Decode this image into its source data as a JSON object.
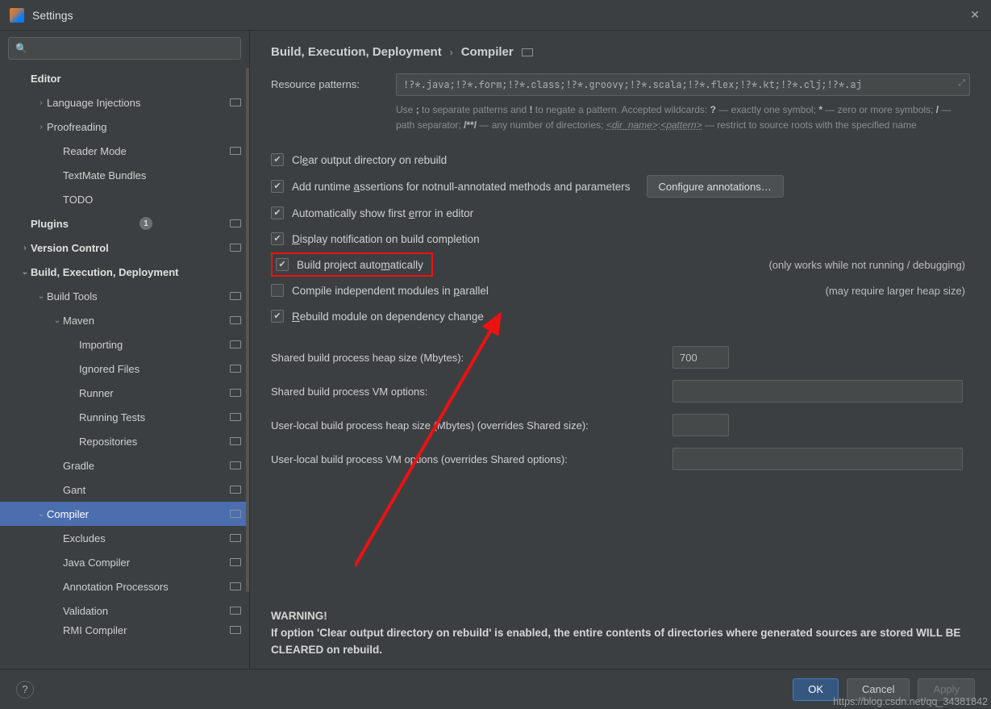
{
  "window": {
    "title": "Settings"
  },
  "sidebar": {
    "search_placeholder": "",
    "items": [
      {
        "label": "Editor",
        "depth": 0,
        "header": true,
        "arrow": "",
        "badge": false
      },
      {
        "label": "Language Injections",
        "depth": 1,
        "arrow": "›",
        "badge": true
      },
      {
        "label": "Proofreading",
        "depth": 1,
        "arrow": "›",
        "badge": false
      },
      {
        "label": "Reader Mode",
        "depth": 2,
        "arrow": "",
        "badge": true
      },
      {
        "label": "TextMate Bundles",
        "depth": 2,
        "arrow": "",
        "badge": false
      },
      {
        "label": "TODO",
        "depth": 2,
        "arrow": "",
        "badge": false
      },
      {
        "label": "Plugins",
        "depth": 0,
        "header": true,
        "arrow": "",
        "count": "1",
        "badge": true
      },
      {
        "label": "Version Control",
        "depth": 0,
        "header": true,
        "arrow": "›",
        "badge": true
      },
      {
        "label": "Build, Execution, Deployment",
        "depth": 0,
        "header": true,
        "arrow": "⌄",
        "badge": false
      },
      {
        "label": "Build Tools",
        "depth": 1,
        "arrow": "⌄",
        "badge": true
      },
      {
        "label": "Maven",
        "depth": 2,
        "arrow": "⌄",
        "badge": true
      },
      {
        "label": "Importing",
        "depth": 3,
        "arrow": "",
        "badge": true
      },
      {
        "label": "Ignored Files",
        "depth": 3,
        "arrow": "",
        "badge": true
      },
      {
        "label": "Runner",
        "depth": 3,
        "arrow": "",
        "badge": true
      },
      {
        "label": "Running Tests",
        "depth": 3,
        "arrow": "",
        "badge": true
      },
      {
        "label": "Repositories",
        "depth": 3,
        "arrow": "",
        "badge": true
      },
      {
        "label": "Gradle",
        "depth": 2,
        "arrow": "",
        "badge": true
      },
      {
        "label": "Gant",
        "depth": 2,
        "arrow": "",
        "badge": true
      },
      {
        "label": "Compiler",
        "depth": 1,
        "arrow": "⌄",
        "selected": true,
        "badge": true
      },
      {
        "label": "Excludes",
        "depth": 2,
        "arrow": "",
        "badge": true
      },
      {
        "label": "Java Compiler",
        "depth": 2,
        "arrow": "",
        "badge": true
      },
      {
        "label": "Annotation Processors",
        "depth": 2,
        "arrow": "",
        "badge": true
      },
      {
        "label": "Validation",
        "depth": 2,
        "arrow": "",
        "badge": true
      },
      {
        "label": "RMI Compiler",
        "depth": 2,
        "arrow": "",
        "badge": true,
        "cut": true
      }
    ]
  },
  "breadcrumb": {
    "a": "Build, Execution, Deployment",
    "b": "Compiler"
  },
  "rp": {
    "label": "Resource patterns:",
    "value": "!?*.java;!?*.form;!?*.class;!?*.groovy;!?*.scala;!?*.flex;!?*.kt;!?*.clj;!?*.aj",
    "hint_parts": {
      "p1": "Use ",
      "s": ";",
      "p2": " to separate patterns and ",
      "ex": "!",
      "p3": " to negate a pattern. Accepted wildcards: ",
      "q": "?",
      "p4": " — exactly one symbol; ",
      "ast": "*",
      "p5": " — zero or more symbols; ",
      "sl": "/",
      "p6": " — path separator; ",
      "dbl": "/**/",
      "p7": " — any number of directories; ",
      "dn": "<dir_name>",
      "col": ":",
      "pat": "<pattern>",
      "p8": " — restrict to source roots with the specified name"
    }
  },
  "checks": {
    "c0": {
      "on": true,
      "pre": "Cl",
      "mn": "e",
      "post": "ar output directory on rebuild"
    },
    "c1": {
      "on": true,
      "pre": "Add runtime ",
      "mn": "a",
      "post": "ssertions for notnull-annotated methods and parameters"
    },
    "c2": {
      "on": true,
      "pre": "Automatically show first ",
      "mn": "e",
      "post": "rror in editor"
    },
    "c3": {
      "on": true,
      "pre": "",
      "mn": "D",
      "post": "isplay notification on build completion"
    },
    "c4": {
      "on": true,
      "pre": "Build project auto",
      "mn": "m",
      "post": "atically",
      "aside": "(only works while not running / debugging)"
    },
    "c5": {
      "on": false,
      "pre": "Compile independent modules in ",
      "mn": "p",
      "post": "arallel",
      "aside": "(may require larger heap size)"
    },
    "c6": {
      "on": true,
      "pre": "",
      "mn": "R",
      "post": "ebuild module on dependency change"
    }
  },
  "annot_btn": "Configure annotations…",
  "form": {
    "f0": {
      "label": "Shared build process heap size (Mbytes):",
      "value": "700",
      "size": "sm"
    },
    "f1": {
      "label": "Shared build process VM options:",
      "value": "",
      "size": "lg"
    },
    "f2": {
      "label": "User-local build process heap size (Mbytes) (overrides Shared size):",
      "value": "",
      "size": "sm"
    },
    "f3": {
      "label": "User-local build process VM options (overrides Shared options):",
      "value": "",
      "size": "lg"
    }
  },
  "warn": {
    "title": "WARNING!",
    "text": "If option 'Clear output directory on rebuild' is enabled, the entire contents of directories where generated sources are stored WILL BE CLEARED on rebuild."
  },
  "buttons": {
    "ok": "OK",
    "cancel": "Cancel",
    "apply": "Apply"
  },
  "watermark": "https://blog.csdn.net/qq_34381842"
}
